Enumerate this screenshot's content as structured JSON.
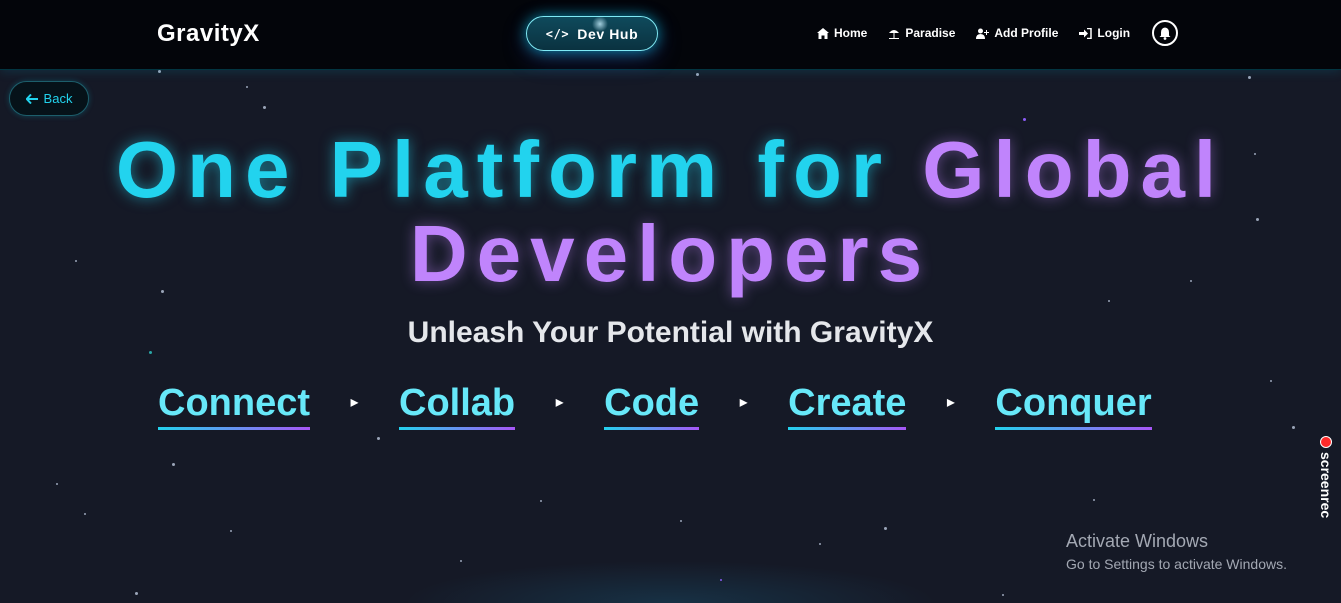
{
  "navbar": {
    "brand": "GravityX",
    "dev_hub": "Dev Hub",
    "links": [
      {
        "label": "Home",
        "icon": "home-icon"
      },
      {
        "label": "Paradise",
        "icon": "beach-umbrella-icon"
      },
      {
        "label": "Add Profile",
        "icon": "user-plus-icon"
      },
      {
        "label": "Login",
        "icon": "sign-in-icon"
      }
    ],
    "notification_icon": "bell-icon"
  },
  "back_button": {
    "label": "Back",
    "icon": "arrow-left-icon"
  },
  "hero": {
    "headline_part1": "One Platform for",
    "headline_part2": "Global",
    "headline_part3": "Developers",
    "subtitle": "Unleash Your Potential with GravityX",
    "steps": [
      "Connect",
      "Collab",
      "Code",
      "Create",
      "Conquer"
    ],
    "separator_icon": "triangle-right-icon"
  },
  "overlays": {
    "screenrec": "screenrec",
    "activate_title": "Activate Windows",
    "activate_subtitle": "Go to Settings to activate Windows."
  },
  "colors": {
    "accent_cyan": "#22d3ee",
    "accent_purple": "#c084fc",
    "background": "#151926",
    "navbar": "#03050a"
  }
}
